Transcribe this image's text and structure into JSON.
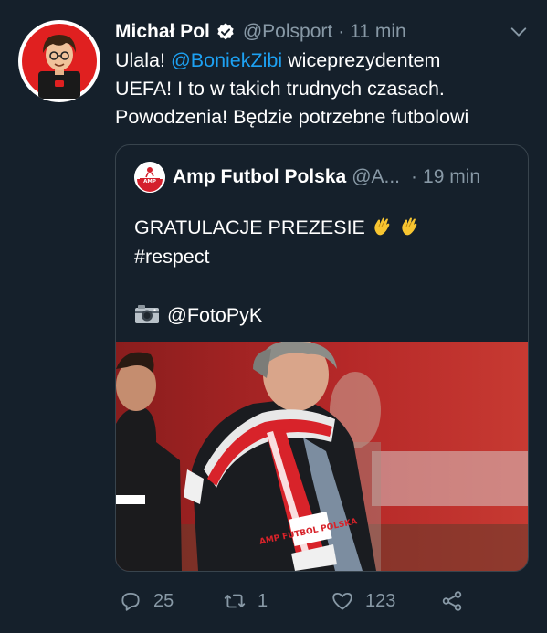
{
  "tweet": {
    "author_name": "Michał Pol",
    "handle": "@Polsport",
    "separator": "·",
    "time": "11 min",
    "text": {
      "line1_prefix": "Ulala! ",
      "mention": "@BoniekZibi",
      "line1_suffix": " wiceprezydentem",
      "line2": "UEFA! I to w takich trudnych czasach.",
      "line3": "Powodzenia! Będzie potrzebne futbolowi"
    }
  },
  "quote": {
    "author_name": "Amp Futbol Polska",
    "handle": "@A...",
    "separator": "·",
    "time": "19 min",
    "line1": "GRATULACJE PREZESIE",
    "line2": "#respect",
    "credit": "@FotoPyK",
    "photo_scarf_text": "AMP FUTBOL POLSKA"
  },
  "actions": {
    "replies": "25",
    "retweets": "1",
    "likes": "123"
  },
  "colors": {
    "background": "#15202b",
    "secondary_text": "#8899a6",
    "link": "#1da1f2",
    "card_border": "#38444d"
  },
  "icons": [
    "verified-badge-icon",
    "chevron-down-icon",
    "clapping-hands-icon",
    "camera-icon",
    "reply-icon",
    "retweet-icon",
    "like-icon",
    "share-icon"
  ]
}
